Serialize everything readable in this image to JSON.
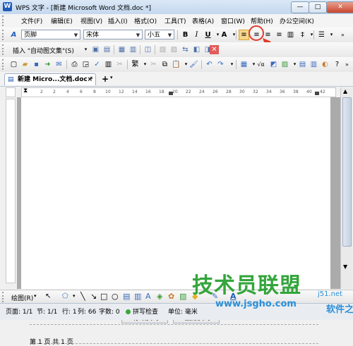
{
  "window": {
    "app_icon": "W",
    "title": "WPS 文字 - [新建 Microsoft Word 文档.doc *]",
    "minimize": "—",
    "maximize": "□",
    "close": "✕"
  },
  "menu": [
    "文件(F)",
    "编辑(E)",
    "视图(V)",
    "插入(I)",
    "格式(O)",
    "工具(T)",
    "表格(A)",
    "窗口(W)",
    "帮助(H)",
    "办公空间(K)"
  ],
  "format_toolbar": {
    "style_value": "页脚",
    "font_value": "宋体",
    "size_value": "小五",
    "bold": "B",
    "italic": "I",
    "underline": "U",
    "text_color": "A",
    "align_left": "≡",
    "align_center": "≡",
    "align_right": "≡",
    "align_justify": "≡",
    "distributed": "▥",
    "line_spacing": "‡",
    "list": "☰"
  },
  "autotext_toolbar": {
    "insert_autotext": "插入 \"自动图文集\"(S)"
  },
  "document_tab": {
    "label": "新建 Micro...文档.doc *",
    "close": "×",
    "new_tab": "+"
  },
  "ruler_ticks": [
    "2",
    "2",
    "4",
    "6",
    "8",
    "10",
    "12",
    "14",
    "16",
    "18",
    "20",
    "22",
    "24",
    "26",
    "28",
    "30",
    "32",
    "34",
    "36",
    "38",
    "40",
    "42"
  ],
  "footer": {
    "text": "第 1 页 共 1 页",
    "edit_page_number": "修改页码",
    "delete_page_number": "删除页码"
  },
  "draw_toolbar": {
    "draw_menu": "绘图(R)"
  },
  "status": {
    "page": "页面: 1/1",
    "section": "节: 1/1",
    "row": "行: 1",
    "col": "列: 66",
    "words": "字数: 0",
    "spell": "拼写检查",
    "unit": "单位: 毫米"
  },
  "watermark": {
    "brand": "技术员联盟",
    "url": "www.jsgho.com",
    "side_url": "j51.net",
    "side_text": "软件之家"
  },
  "colors": {
    "titlebar": "#c3d7ee",
    "accent_highlight": "#f6d78a",
    "annotation_red": "#e03b2d",
    "watermark_green": "#33a53b",
    "watermark_blue": "#2c8fd6"
  }
}
